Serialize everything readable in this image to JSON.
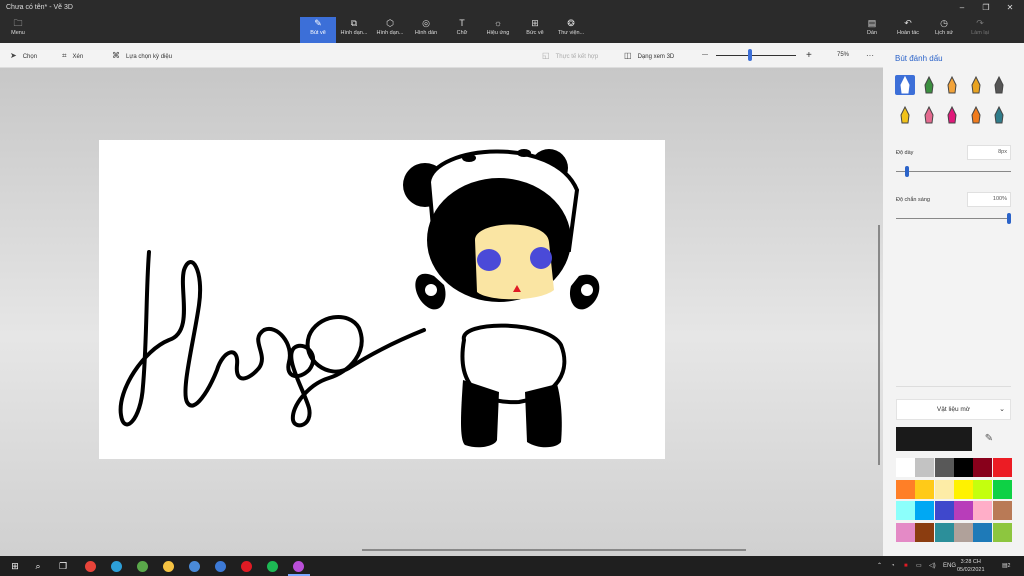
{
  "window": {
    "title": "Chưa có tên* - Vẽ 3D"
  },
  "ribbon": {
    "menu_label": "Menu",
    "tools": [
      {
        "label": "Bút vẽ",
        "icon": "brush-icon",
        "active": true
      },
      {
        "label": "Hình dạn...",
        "icon": "2d-shapes-icon"
      },
      {
        "label": "Hình dạn...",
        "icon": "3d-shapes-icon"
      },
      {
        "label": "Hình dán",
        "icon": "stickers-icon"
      },
      {
        "label": "Chữ",
        "icon": "text-icon"
      },
      {
        "label": "Hiệu ứng",
        "icon": "effects-icon"
      },
      {
        "label": "Bức vẽ",
        "icon": "canvas-icon"
      },
      {
        "label": "Thư viện...",
        "icon": "3d-library-icon"
      }
    ],
    "right_tools": [
      {
        "label": "Dán",
        "icon": "paste-icon"
      },
      {
        "label": "Hoàn tác",
        "icon": "undo-icon"
      },
      {
        "label": "Lịch sử",
        "icon": "history-icon"
      },
      {
        "label": "Làm lại",
        "icon": "redo-icon",
        "disabled": true
      }
    ]
  },
  "subtoolbar": {
    "select_label": "Chọn",
    "crop_label": "Xén",
    "magic_select_label": "Lựa chọn kỳ diệu",
    "mixed_reality_label": "Thực tế kết hợp",
    "view3d_label": "Dạng xem 3D",
    "zoom_minus": "—",
    "zoom_plus": "+",
    "zoom_value": "75%",
    "zoom_fraction": 0.42,
    "more": "···"
  },
  "panel": {
    "title": "Bút đánh dấu",
    "brushes": [
      {
        "icon": "marker-icon",
        "color": "#ffffff",
        "selected": true
      },
      {
        "icon": "calligraphy-pen-icon",
        "color": "#3b8f3f"
      },
      {
        "icon": "oil-brush-icon",
        "color": "#f2a33a"
      },
      {
        "icon": "watercolor-icon",
        "color": "#e8a321"
      },
      {
        "icon": "pixel-pen-icon",
        "color": "#555555"
      },
      {
        "icon": "pencil-icon",
        "color": "#f1c21b"
      },
      {
        "icon": "eraser-icon",
        "color": "#e46a8f"
      },
      {
        "icon": "crayon-icon",
        "color": "#e0197a"
      },
      {
        "icon": "spray-can-icon",
        "color": "#f07b1d"
      },
      {
        "icon": "fill-icon",
        "color": "#2f7c8a"
      }
    ],
    "thickness_label": "Độ dày",
    "thickness_value": "8px",
    "thickness_fraction": 0.08,
    "opacity_label": "Độ chắn sáng",
    "opacity_value": "100%",
    "opacity_fraction": 1.0,
    "material_label": "Vật liệu mờ",
    "current_color": "#1a1a1a",
    "swatches": [
      "#ffffff",
      "#c3c3c3",
      "#585858",
      "#000000",
      "#88001b",
      "#ec1c24",
      "#ff7f27",
      "#ffca18",
      "#fdeca6",
      "#fff200",
      "#c4ff0e",
      "#0ed145",
      "#8cfffb",
      "#00a8f3",
      "#3f48cc",
      "#b83dba",
      "#ffaec8",
      "#b97a56",
      "#e48ac6",
      "#8b3d10",
      "#2c8f9a",
      "#b0a19a",
      "#1e7ab8",
      "#8dc63f"
    ]
  },
  "taskbar": {
    "apps": [
      {
        "icon": "windows-start-icon",
        "color": "#ffffff"
      },
      {
        "icon": "search-icon",
        "color": "#ffffff"
      },
      {
        "icon": "task-view-icon",
        "color": "#ffffff"
      },
      {
        "icon": "chrome-icon",
        "color": "#e8443a"
      },
      {
        "icon": "edge-icon",
        "color": "#2d9fd8"
      },
      {
        "icon": "coccoc-icon",
        "color": "#5aa84a"
      },
      {
        "icon": "file-explorer-icon",
        "color": "#f5c242"
      },
      {
        "icon": "store-icon",
        "color": "#4a8ad8"
      },
      {
        "icon": "mail-icon",
        "color": "#3d7ad6"
      },
      {
        "icon": "pinterest-icon",
        "color": "#e01b24"
      },
      {
        "icon": "spotify-icon",
        "color": "#1db954"
      },
      {
        "icon": "paint3d-icon",
        "color": "#b94fd8"
      }
    ],
    "language": "ENG",
    "time": "3:28 CH",
    "date": "05/02/2021",
    "notifications": "2"
  }
}
